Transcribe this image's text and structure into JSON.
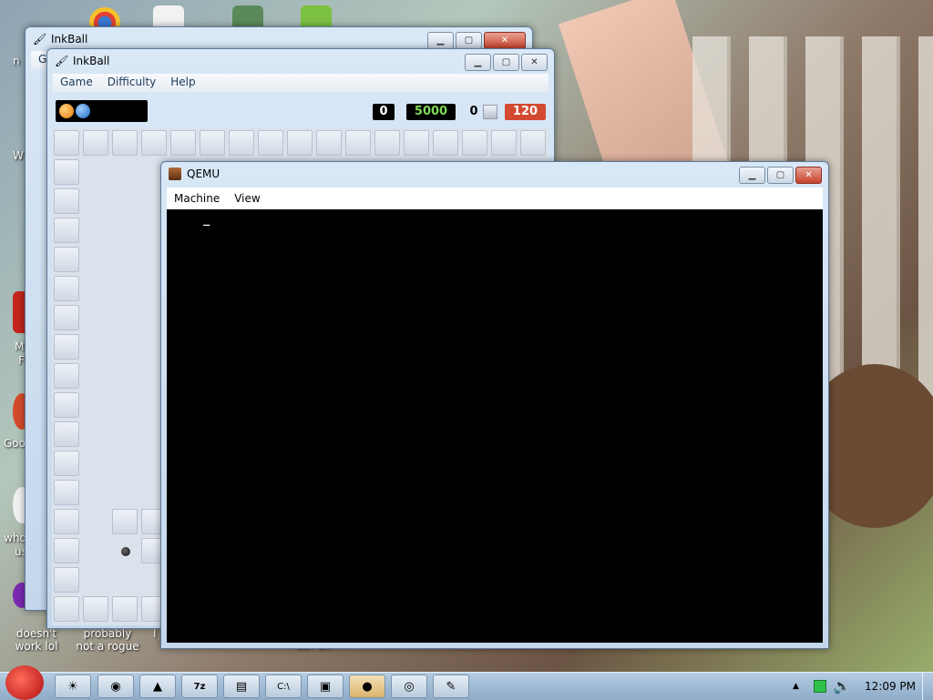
{
  "desktop": {
    "labels": [
      {
        "id": "doesnt-work",
        "text": "doesn't work lol"
      },
      {
        "id": "probably-not",
        "text": "probably not a rogue"
      },
      {
        "id": "left-n",
        "text": "n"
      },
      {
        "id": "left-w",
        "text": "W"
      },
      {
        "id": "left-m",
        "text": "M"
      },
      {
        "id": "left-f",
        "text": "F"
      },
      {
        "id": "left-goo",
        "text": "Goo"
      },
      {
        "id": "left-who",
        "text": "who"
      },
      {
        "id": "left-us",
        "text": "us"
      },
      {
        "id": "bet",
        "text": "BET C..."
      },
      {
        "id": "left-i",
        "text": "I"
      }
    ]
  },
  "inkball_back": {
    "title": "InkBall",
    "menu_g": "G"
  },
  "inkball": {
    "title": "InkBall",
    "menu": [
      "Game",
      "Difficulty",
      "Help"
    ],
    "score_left": "0",
    "score_points": "5000",
    "score_balls": "0",
    "timer": "120",
    "colors": {
      "score_bg": "#000000",
      "points_fg": "#7ed957",
      "timer_bg": "#d24a32"
    }
  },
  "qemu": {
    "title": "QEMU",
    "menu": [
      "Machine",
      "View"
    ],
    "console_cursor": "_"
  },
  "taskbar": {
    "apps": [
      "start-orb",
      "weather-icon",
      "chrome-icon",
      "tool-icon",
      "7zip-icon",
      "notepad-icon",
      "cmd-icon",
      "toolbox-icon",
      "qemu-icon",
      "media-icon",
      "inkball-icon"
    ],
    "tray_up": "▲",
    "time": "12:09 PM"
  }
}
